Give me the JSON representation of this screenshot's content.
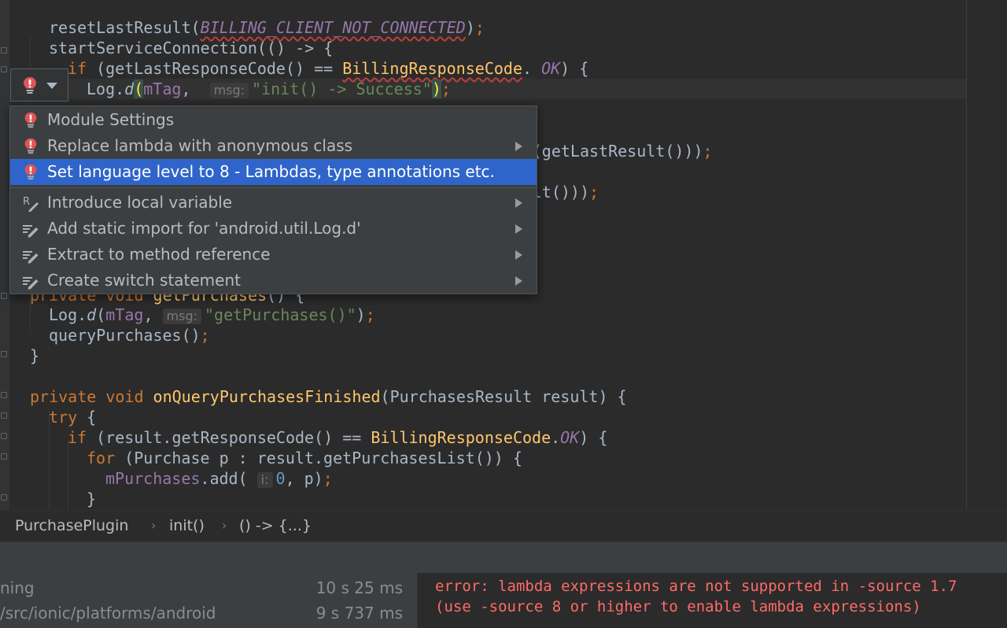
{
  "editor": {
    "code_lines": [
      {
        "parts": [
          [
            "",
            "resetLastResult("
          ],
          [
            "cst sq",
            "BILLING_CLIENT_NOT_CONNECTED"
          ],
          [
            "",
            ")"
          ],
          [
            "kw",
            ";"
          ]
        ]
      },
      {
        "parts": [
          [
            "",
            "startServiceConnection(() -> {"
          ]
        ]
      },
      {
        "parts": [
          [
            "kw",
            "if "
          ],
          [
            "",
            "(getLastResponseCode() == "
          ],
          [
            "fn sq",
            "BillingResponseCode"
          ],
          [
            "",
            ". "
          ],
          [
            "cst",
            "OK"
          ],
          [
            "",
            ") {"
          ]
        ]
      },
      {
        "parts": [
          [
            "",
            "Log."
          ],
          [
            "itl",
            "d"
          ],
          [
            "bracehl",
            "("
          ],
          [
            "fld",
            "mTag"
          ],
          [
            "",
            ",  "
          ],
          [
            "hint",
            "msg:"
          ],
          [
            "str",
            "\"init() -> Success\""
          ],
          [
            "bracehl",
            ")"
          ],
          [
            "kw",
            ";"
          ]
        ]
      },
      {
        "parts": [
          [
            "",
            "                  ("
          ],
          [
            "",
            "getLastResult()))"
          ],
          [
            "kw",
            ";"
          ]
        ]
      },
      {
        "parts": [
          [
            "",
            "                  lt()))"
          ],
          [
            "kw",
            ";"
          ]
        ]
      },
      {
        "parts": [
          [
            "kw",
            "private void "
          ],
          [
            "fn",
            "getPurchases"
          ],
          [
            "",
            "() {"
          ]
        ]
      },
      {
        "parts": [
          [
            "",
            "Log."
          ],
          [
            "itl",
            "d"
          ],
          [
            "",
            "("
          ],
          [
            "fld",
            "mTag"
          ],
          [
            "",
            ", "
          ],
          [
            "hint",
            "msg:"
          ],
          [
            "str",
            "\"getPurchases()\""
          ],
          [
            "",
            ")"
          ],
          [
            "kw",
            ";"
          ]
        ]
      },
      {
        "parts": [
          [
            "",
            "queryPurchases()"
          ],
          [
            "kw",
            ";"
          ]
        ]
      },
      {
        "parts": [
          [
            "",
            "}"
          ]
        ]
      },
      {
        "parts": [
          [
            "kw",
            "private void "
          ],
          [
            "fn",
            "onQueryPurchasesFinished"
          ],
          [
            "",
            "(PurchasesResult result) {"
          ]
        ]
      },
      {
        "parts": [
          [
            "kw",
            "try "
          ],
          [
            "",
            "{"
          ]
        ]
      },
      {
        "parts": [
          [
            "kw",
            "if "
          ],
          [
            "",
            "(result.getResponseCode() == "
          ],
          [
            "fn",
            "BillingResponseCode"
          ],
          [
            "",
            "."
          ],
          [
            "cst",
            "OK"
          ],
          [
            "",
            ") {"
          ]
        ]
      },
      {
        "parts": [
          [
            "kw",
            "for "
          ],
          [
            "",
            "(Purchase p : result.getPurchasesList()) {"
          ]
        ]
      },
      {
        "parts": [
          [
            "fld",
            "mPurchases"
          ],
          [
            "",
            ".add( "
          ],
          [
            "hint",
            "i:"
          ],
          [
            "num",
            "0"
          ],
          [
            "",
            ", p)"
          ],
          [
            "kw",
            ";"
          ]
        ]
      },
      {
        "parts": [
          [
            "",
            "}"
          ]
        ]
      }
    ]
  },
  "intention_popup": {
    "items": [
      {
        "label": "Module Settings",
        "icon": "error-bulb-icon",
        "submenu": false,
        "selected": false
      },
      {
        "label": "Replace lambda with anonymous class",
        "icon": "error-bulb-icon",
        "submenu": true,
        "selected": false
      },
      {
        "label": "Set language level to 8 - Lambdas, type annotations etc.",
        "icon": "error-bulb-icon",
        "submenu": false,
        "selected": true
      },
      {
        "label": "Introduce local variable",
        "icon": "refactor-icon",
        "submenu": true,
        "selected": false
      },
      {
        "label": "Add static import for 'android.util.Log.d'",
        "icon": "intention-pencil-icon",
        "submenu": true,
        "selected": false
      },
      {
        "label": "Extract to method reference",
        "icon": "intention-pencil-icon",
        "submenu": true,
        "selected": false
      },
      {
        "label": "Create switch statement",
        "icon": "intention-pencil-icon",
        "submenu": true,
        "selected": false
      }
    ]
  },
  "breadcrumb": {
    "items": [
      "PurchasePlugin",
      "init()",
      "() -> {...}"
    ]
  },
  "build_panel": {
    "rows": [
      {
        "name": "ning",
        "duration": "10 s 25 ms"
      },
      {
        "name": "/src/ionic/platforms/android",
        "duration": "9 s 737 ms"
      }
    ]
  },
  "console": {
    "lines": [
      "error: lambda expressions are not supported in -source 1.7",
      "(use -source 8 or higher to enable lambda expressions)"
    ]
  },
  "colors": {
    "background": "#2b2b2b",
    "selection": "#2f65ca",
    "error": "#ff6b68",
    "keyword": "#cc7832",
    "string": "#6a8759"
  }
}
